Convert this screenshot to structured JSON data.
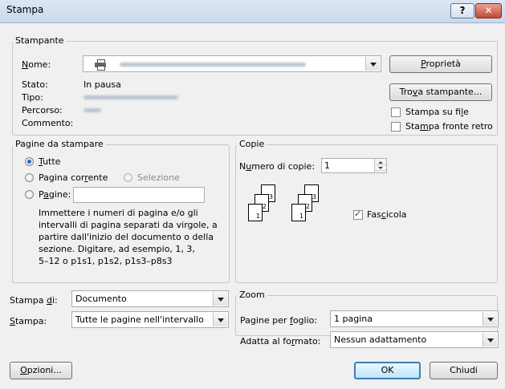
{
  "window": {
    "title": "Stampa",
    "help_glyph": "?",
    "close_glyph": "✕"
  },
  "printer": {
    "legend": "Stampante",
    "name_label": "Nome:",
    "status_label": "Stato:",
    "status_value": "In pausa",
    "type_label": "Tipo:",
    "location_label": "Percorso:",
    "comment_label": "Commento:",
    "properties_button": "Proprietà",
    "find_printer_button": "Trova stampante...",
    "print_to_file_label": "Stampa su file",
    "duplex_label": "Stampa fronte retro"
  },
  "page_range": {
    "legend": "Pagine da stampare",
    "all_label": "Tutte",
    "current_label": "Pagina corrente",
    "selection_label": "Selezione",
    "pages_label": "Pagine:",
    "pages_value": "",
    "help_lines": [
      "Immettere i numeri di pagina e/o gli",
      "intervalli di pagina separati da virgole, a",
      "partire dall'inizio del documento o della",
      "sezione. Digitare, ad esempio, 1, 3,",
      "5–12 o p1s1, p1s2, p1s3–p8s3"
    ]
  },
  "copies": {
    "legend": "Copie",
    "count_label": "Numero di copie:",
    "count_value": "1",
    "collate_label": "Fascicola",
    "collate_checked": true,
    "page_numbers": [
      "1",
      "2",
      "3"
    ]
  },
  "print_what": {
    "label": "Stampa di:",
    "value": "Documento"
  },
  "print": {
    "label": "Stampa:",
    "value": "Tutte le pagine nell'intervallo"
  },
  "zoom": {
    "legend": "Zoom",
    "pages_per_sheet_label": "Pagine per foglio:",
    "pages_per_sheet_value": "1 pagina",
    "scale_label": "Adatta al formato:",
    "scale_value": "Nessun adattamento"
  },
  "footer": {
    "options_button": "Opzioni...",
    "ok_button": "OK",
    "close_button": "Chiudi"
  },
  "colors": {
    "accent": "#2a63c8",
    "titlebar": "#c9d9ec",
    "close": "#c34a36"
  }
}
